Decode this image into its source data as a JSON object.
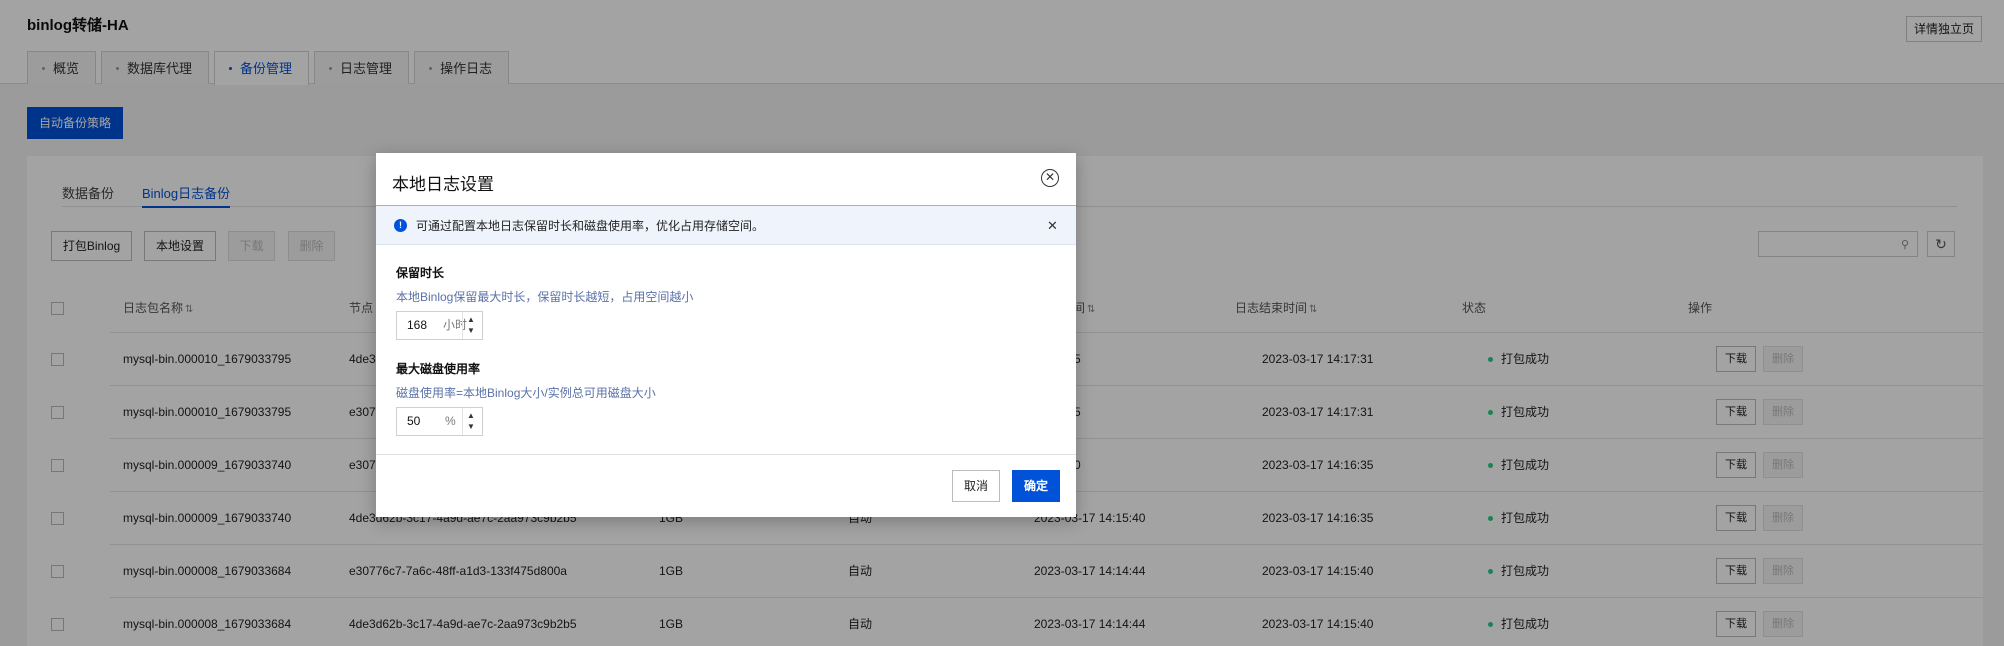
{
  "app": {
    "title": "binlog转储-HA",
    "detail_button": "详情独立页"
  },
  "tabs": [
    "概览",
    "数据库代理",
    "备份管理",
    "日志管理",
    "操作日志"
  ],
  "active_tab": "备份管理",
  "auto_backup_button": "自动备份策略",
  "subtabs": {
    "data_backup": "数据备份",
    "binlog_backup": "Binlog日志备份"
  },
  "toolbar": {
    "pack": "打包Binlog",
    "local_settings": "本地设置",
    "download": "下载",
    "delete": "删除"
  },
  "table": {
    "headers": {
      "name": "日志包名称",
      "node": "节点",
      "start_time_suffix": "间",
      "end_time": "日志结束时间",
      "status": "状态",
      "action": "操作"
    },
    "rows": [
      {
        "name": "mysql-bin.000010_1679033795",
        "node": "4de3",
        "size": "",
        "mode": "",
        "start": "14:16:35",
        "end": "2023-03-17 14:17:31",
        "status": "打包成功"
      },
      {
        "name": "mysql-bin.000010_1679033795",
        "node": "e307",
        "size": "",
        "mode": "",
        "start": "14:16:35",
        "end": "2023-03-17 14:17:31",
        "status": "打包成功"
      },
      {
        "name": "mysql-bin.000009_1679033740",
        "node": "e307",
        "size": "",
        "mode": "",
        "start": "14:15:40",
        "end": "2023-03-17 14:16:35",
        "status": "打包成功"
      },
      {
        "name": "mysql-bin.000009_1679033740",
        "node": "4de3d62b-3c17-4a9d-ae7c-2aa973c9b2b5",
        "size": "1GB",
        "mode": "自动",
        "start": "2023-03-17 14:15:40",
        "end": "2023-03-17 14:16:35",
        "status": "打包成功"
      },
      {
        "name": "mysql-bin.000008_1679033684",
        "node": "e30776c7-7a6c-48ff-a1d3-133f475d800a",
        "size": "1GB",
        "mode": "自动",
        "start": "2023-03-17 14:14:44",
        "end": "2023-03-17 14:15:40",
        "status": "打包成功"
      },
      {
        "name": "mysql-bin.000008_1679033684",
        "node": "4de3d62b-3c17-4a9d-ae7c-2aa973c9b2b5",
        "size": "1GB",
        "mode": "自动",
        "start": "2023-03-17 14:14:44",
        "end": "2023-03-17 14:15:40",
        "status": "打包成功"
      }
    ],
    "row_actions": {
      "download": "下载",
      "delete": "删除"
    }
  },
  "modal": {
    "title": "本地日志设置",
    "notice": "可通过配置本地日志保留时长和磁盘使用率，优化占用存储空间。",
    "retention": {
      "label": "保留时长",
      "hint": "本地Binlog保留最大时长，保留时长越短，占用空间越小",
      "value": "168",
      "unit": "小时"
    },
    "disk": {
      "label": "最大磁盘使用率",
      "hint": "磁盘使用率=本地Binlog大小/实例总可用磁盘大小",
      "value": "50",
      "unit": "%"
    },
    "cancel": "取消",
    "confirm": "确定"
  },
  "colors": {
    "primary": "#0052d9",
    "success": "#29cc85"
  },
  "icons": [
    "close-circle-icon",
    "info-icon",
    "close-icon",
    "search-icon",
    "refresh-icon",
    "sort-icon",
    "chevron-up-icon",
    "chevron-down-icon"
  ]
}
